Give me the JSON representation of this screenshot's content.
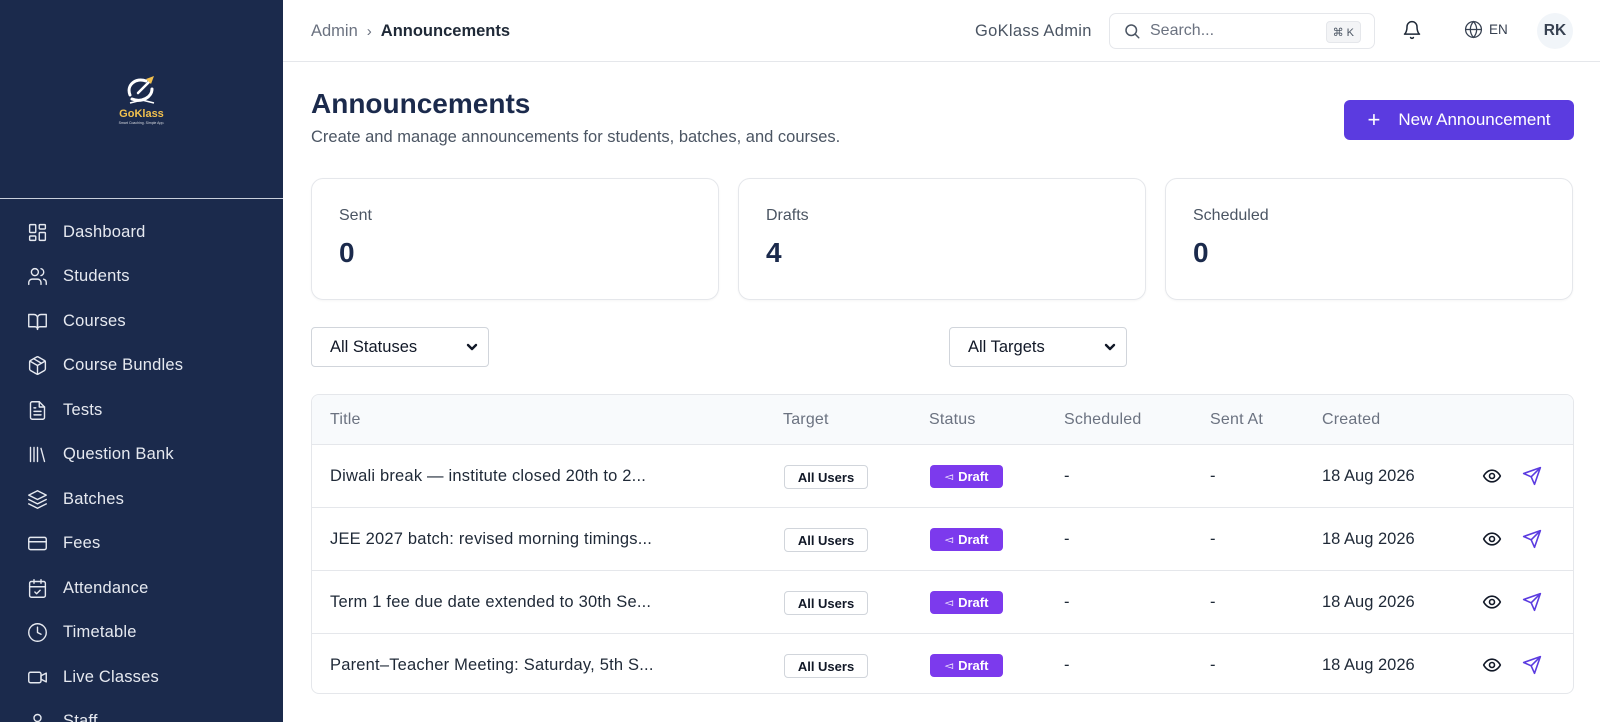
{
  "sidebar": {
    "brand": "GoKlass",
    "tagline": "Smart Coaching. Simple App.",
    "items": [
      {
        "label": "Dashboard",
        "icon": "dashboard-icon"
      },
      {
        "label": "Students",
        "icon": "users-icon"
      },
      {
        "label": "Courses",
        "icon": "book-open-icon"
      },
      {
        "label": "Course Bundles",
        "icon": "package-icon"
      },
      {
        "label": "Tests",
        "icon": "file-text-icon"
      },
      {
        "label": "Question Bank",
        "icon": "library-icon"
      },
      {
        "label": "Batches",
        "icon": "layers-icon"
      },
      {
        "label": "Fees",
        "icon": "credit-card-icon"
      },
      {
        "label": "Attendance",
        "icon": "calendar-check-icon"
      },
      {
        "label": "Timetable",
        "icon": "clock-icon"
      },
      {
        "label": "Live Classes",
        "icon": "video-icon"
      },
      {
        "label": "Staff",
        "icon": "user-icon"
      }
    ]
  },
  "topbar": {
    "breadcrumb_root": "Admin",
    "breadcrumb_sep": "›",
    "breadcrumb_current": "Announcements",
    "org_name": "GoKlass Admin",
    "search_placeholder": "Search...",
    "search_shortcut": "⌘ K",
    "language": "EN",
    "avatar_initials": "RK"
  },
  "page": {
    "title": "Announcements",
    "subtitle": "Create and manage announcements for students, batches, and courses.",
    "new_button": "New Announcement"
  },
  "stats": [
    {
      "label": "Sent",
      "value": "0"
    },
    {
      "label": "Drafts",
      "value": "4"
    },
    {
      "label": "Scheduled",
      "value": "0"
    }
  ],
  "filters": {
    "status_selected": "All Statuses",
    "target_selected": "All Targets"
  },
  "table": {
    "columns": [
      "Title",
      "Target",
      "Status",
      "Scheduled",
      "Sent At",
      "Created"
    ],
    "rows": [
      {
        "title": "Diwali break — institute closed 20th to 2...",
        "target": "All Users",
        "status": "Draft",
        "scheduled": "-",
        "sent_at": "-",
        "created": "18 Aug 2026"
      },
      {
        "title": "JEE 2027 batch: revised morning timings...",
        "target": "All Users",
        "status": "Draft",
        "scheduled": "-",
        "sent_at": "-",
        "created": "18 Aug 2026"
      },
      {
        "title": "Term 1 fee due date extended to 30th Se...",
        "target": "All Users",
        "status": "Draft",
        "scheduled": "-",
        "sent_at": "-",
        "created": "18 Aug 2026"
      },
      {
        "title": "Parent–Teacher Meeting: Saturday, 5th S...",
        "target": "All Users",
        "status": "Draft",
        "scheduled": "-",
        "sent_at": "-",
        "created": "18 Aug 2026"
      }
    ]
  },
  "colors": {
    "sidebar_bg": "#1b2a4c",
    "primary": "#5b3be0",
    "draft_badge": "#7c3aed",
    "action_icon": "#5b3be0"
  }
}
